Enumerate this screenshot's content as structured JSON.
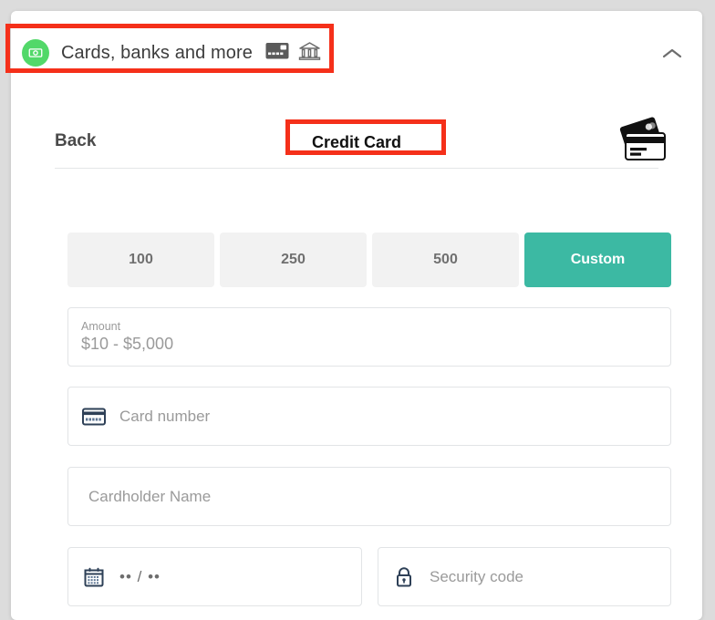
{
  "header": {
    "title": "Cards, banks and more",
    "wallet_icon": "money-bill-icon",
    "card_icon": "credit-card-icon",
    "bank_icon": "bank-icon",
    "collapse_icon": "chevron-up-icon"
  },
  "subheader": {
    "back_label": "Back",
    "method_title": "Credit Card",
    "card_art_icon": "stacked-cards-icon"
  },
  "amounts": {
    "options": [
      {
        "label": "100",
        "active": false
      },
      {
        "label": "250",
        "active": false
      },
      {
        "label": "500",
        "active": false
      },
      {
        "label": "Custom",
        "active": true
      }
    ]
  },
  "form": {
    "amount": {
      "label": "Amount",
      "placeholder": "$10 - $5,000"
    },
    "card_number": {
      "placeholder": "Card number",
      "icon": "credit-card-icon"
    },
    "cardholder": {
      "placeholder": "Cardholder Name"
    },
    "expiry": {
      "placeholder": "•• / ••",
      "icon": "calendar-icon"
    },
    "security_code": {
      "placeholder": "Security code",
      "icon": "lock-icon"
    }
  },
  "colors": {
    "accent_teal": "#3cb9a3",
    "wallet_green": "#52d869",
    "annotation_red": "#f5301a",
    "page_background": "#dcdcdc",
    "panel_background": "#ffffff"
  }
}
